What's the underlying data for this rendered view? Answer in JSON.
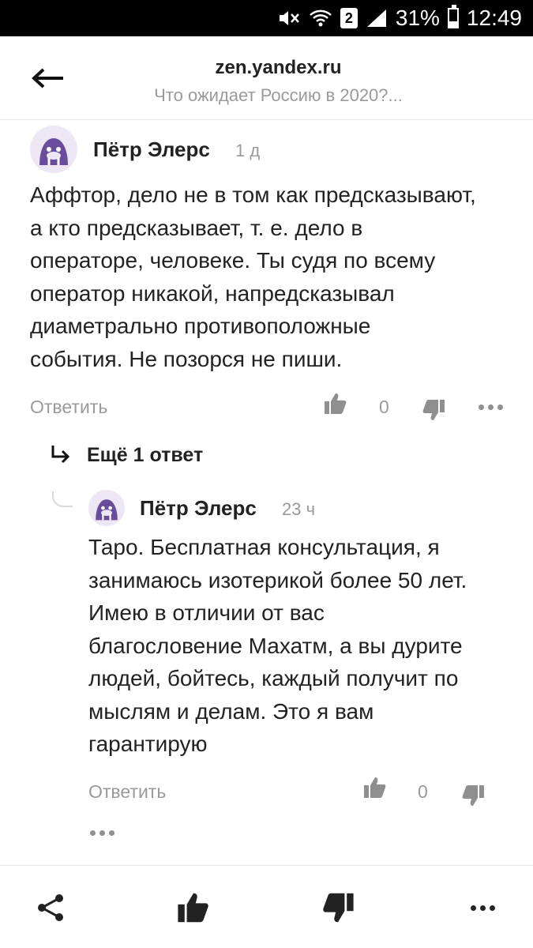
{
  "status_bar": {
    "signal_percent": "31%",
    "sim_label": "2",
    "time": "12:49",
    "battery_level": 0.31,
    "icons": [
      "mute-icon",
      "wifi-icon",
      "sim-icon",
      "signal-icon",
      "battery-icon"
    ]
  },
  "header": {
    "domain": "zen.yandex.ru",
    "subtitle": "Что ожидает Россию в 2020?..."
  },
  "comments": [
    {
      "author": "Пётр Элерс",
      "time": "1 д",
      "text_lines": [
        "Аффтор, дело не в том как предсказывают,",
        "а кто предсказывает, т. е. дело в",
        "операторе, человеке. Ты судя по всему",
        "оператор никакой, напредсказывал",
        "диаметрально противоположные",
        "события. Не позорся не пиши."
      ],
      "reply_label": "Ответить",
      "likes": "0"
    }
  ],
  "more_replies_label": "Ещё 1 ответ",
  "replies": [
    {
      "author": "Пётр Элерс",
      "time": "23 ч",
      "text_lines": [
        "Таро. Бесплатная консультация, я",
        "занимаюсь изотерикой более 50 лет.",
        "Имею в отличии от вас",
        "благословение Махатм, а вы дурите",
        "людей, бойтесь, каждый получит по",
        "мыслям и делам. Это я вам",
        "гарантирую"
      ],
      "reply_label": "Ответить",
      "likes": "0"
    }
  ],
  "colors": {
    "avatar_purple": "#6a4c9c",
    "avatar_bg": "#ece6f5",
    "muted_text": "#9a9a9a",
    "icon_dark": "#222222"
  }
}
